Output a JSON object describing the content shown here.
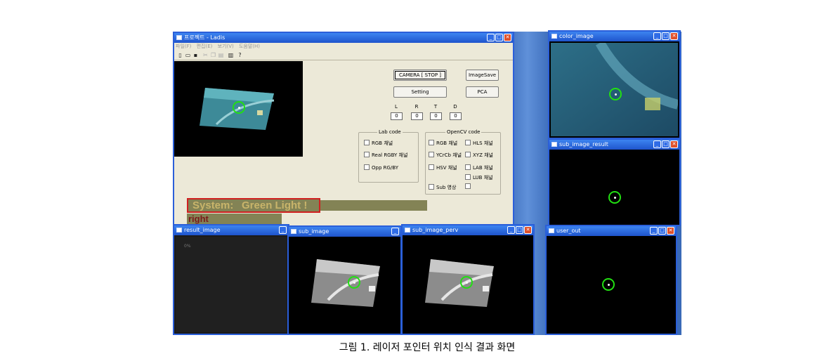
{
  "main_window": {
    "title": "프로젝트 - Ladis",
    "menu": [
      "파일(F)",
      "편집(E)",
      "보기(V)",
      "도움말(H)"
    ],
    "buttons": {
      "camera": "CAMERA [ STOP ]",
      "image_save": "ImageSave",
      "setting": "Setting",
      "pca": "PCA"
    },
    "ltrd_labels": [
      "L",
      "R",
      "T",
      "D"
    ],
    "ltrd_values": [
      "0",
      "0",
      "0",
      "0"
    ],
    "lab_code": {
      "title": "Lab code",
      "options": [
        "RGB 채널",
        "Real RGBY 채널",
        "Opp RG/BY"
      ]
    },
    "opencv_code": {
      "title": "OpenCV code",
      "left_options": [
        "RGB 채널",
        "YCrCb 채널",
        "HSV 채널",
        "Sub 영상"
      ],
      "right_options": [
        "HLS 채널",
        "XYZ 채널",
        "LAB 채널",
        "LUB 채널",
        ""
      ]
    },
    "system_label": "System:",
    "status": "Green Light !",
    "direction": "right"
  },
  "windows": {
    "color_image": "color_image",
    "sub_image_result": "sub_image_result",
    "result_image": "result_image",
    "result_overlay": "0%",
    "sub_image": "sub_image",
    "sub_image_perv": "sub_image_perv",
    "user_out": "user_out"
  },
  "caption": "그림 1. 레이저 포인터 위치 인식 결과 화면",
  "colors": {
    "title_bar": "#1f54cc",
    "detection_circle": "#22e012",
    "status_strip": "#838355",
    "highlight_border": "#d02020"
  },
  "icons": [
    "app-icon",
    "new-icon",
    "open-icon",
    "save-icon",
    "cut-icon",
    "copy-icon",
    "paste-icon",
    "print-icon",
    "help-icon"
  ]
}
